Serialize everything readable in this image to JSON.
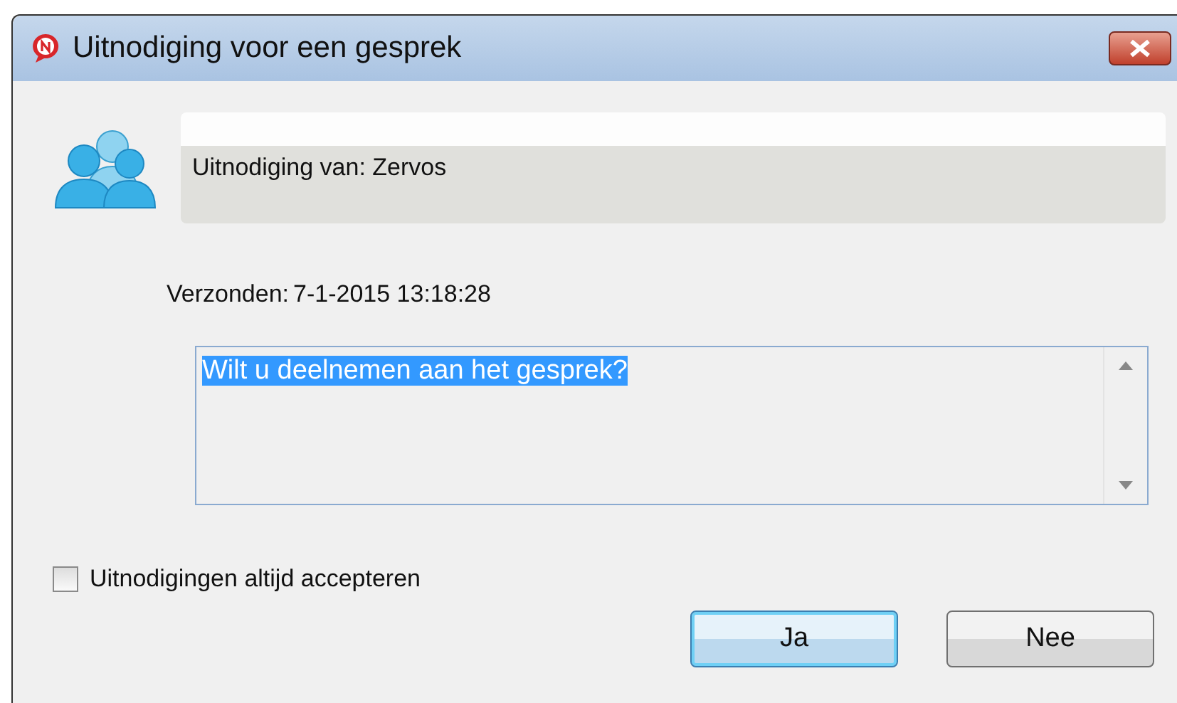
{
  "window": {
    "title": "Uitnodiging voor een gesprek"
  },
  "header": {
    "text": "Uitnodiging van: Zervos"
  },
  "sent": {
    "label": "Verzonden:",
    "value": "7-1-2015 13:18:28"
  },
  "message": {
    "text": "Wilt u deelnemen aan het gesprek?",
    "selected": true
  },
  "always_accept": {
    "label": "Uitnodigingen altijd accepteren",
    "checked": false
  },
  "buttons": [
    {
      "label": "Ja",
      "default": true
    },
    {
      "label": "Nee",
      "default": false
    }
  ]
}
